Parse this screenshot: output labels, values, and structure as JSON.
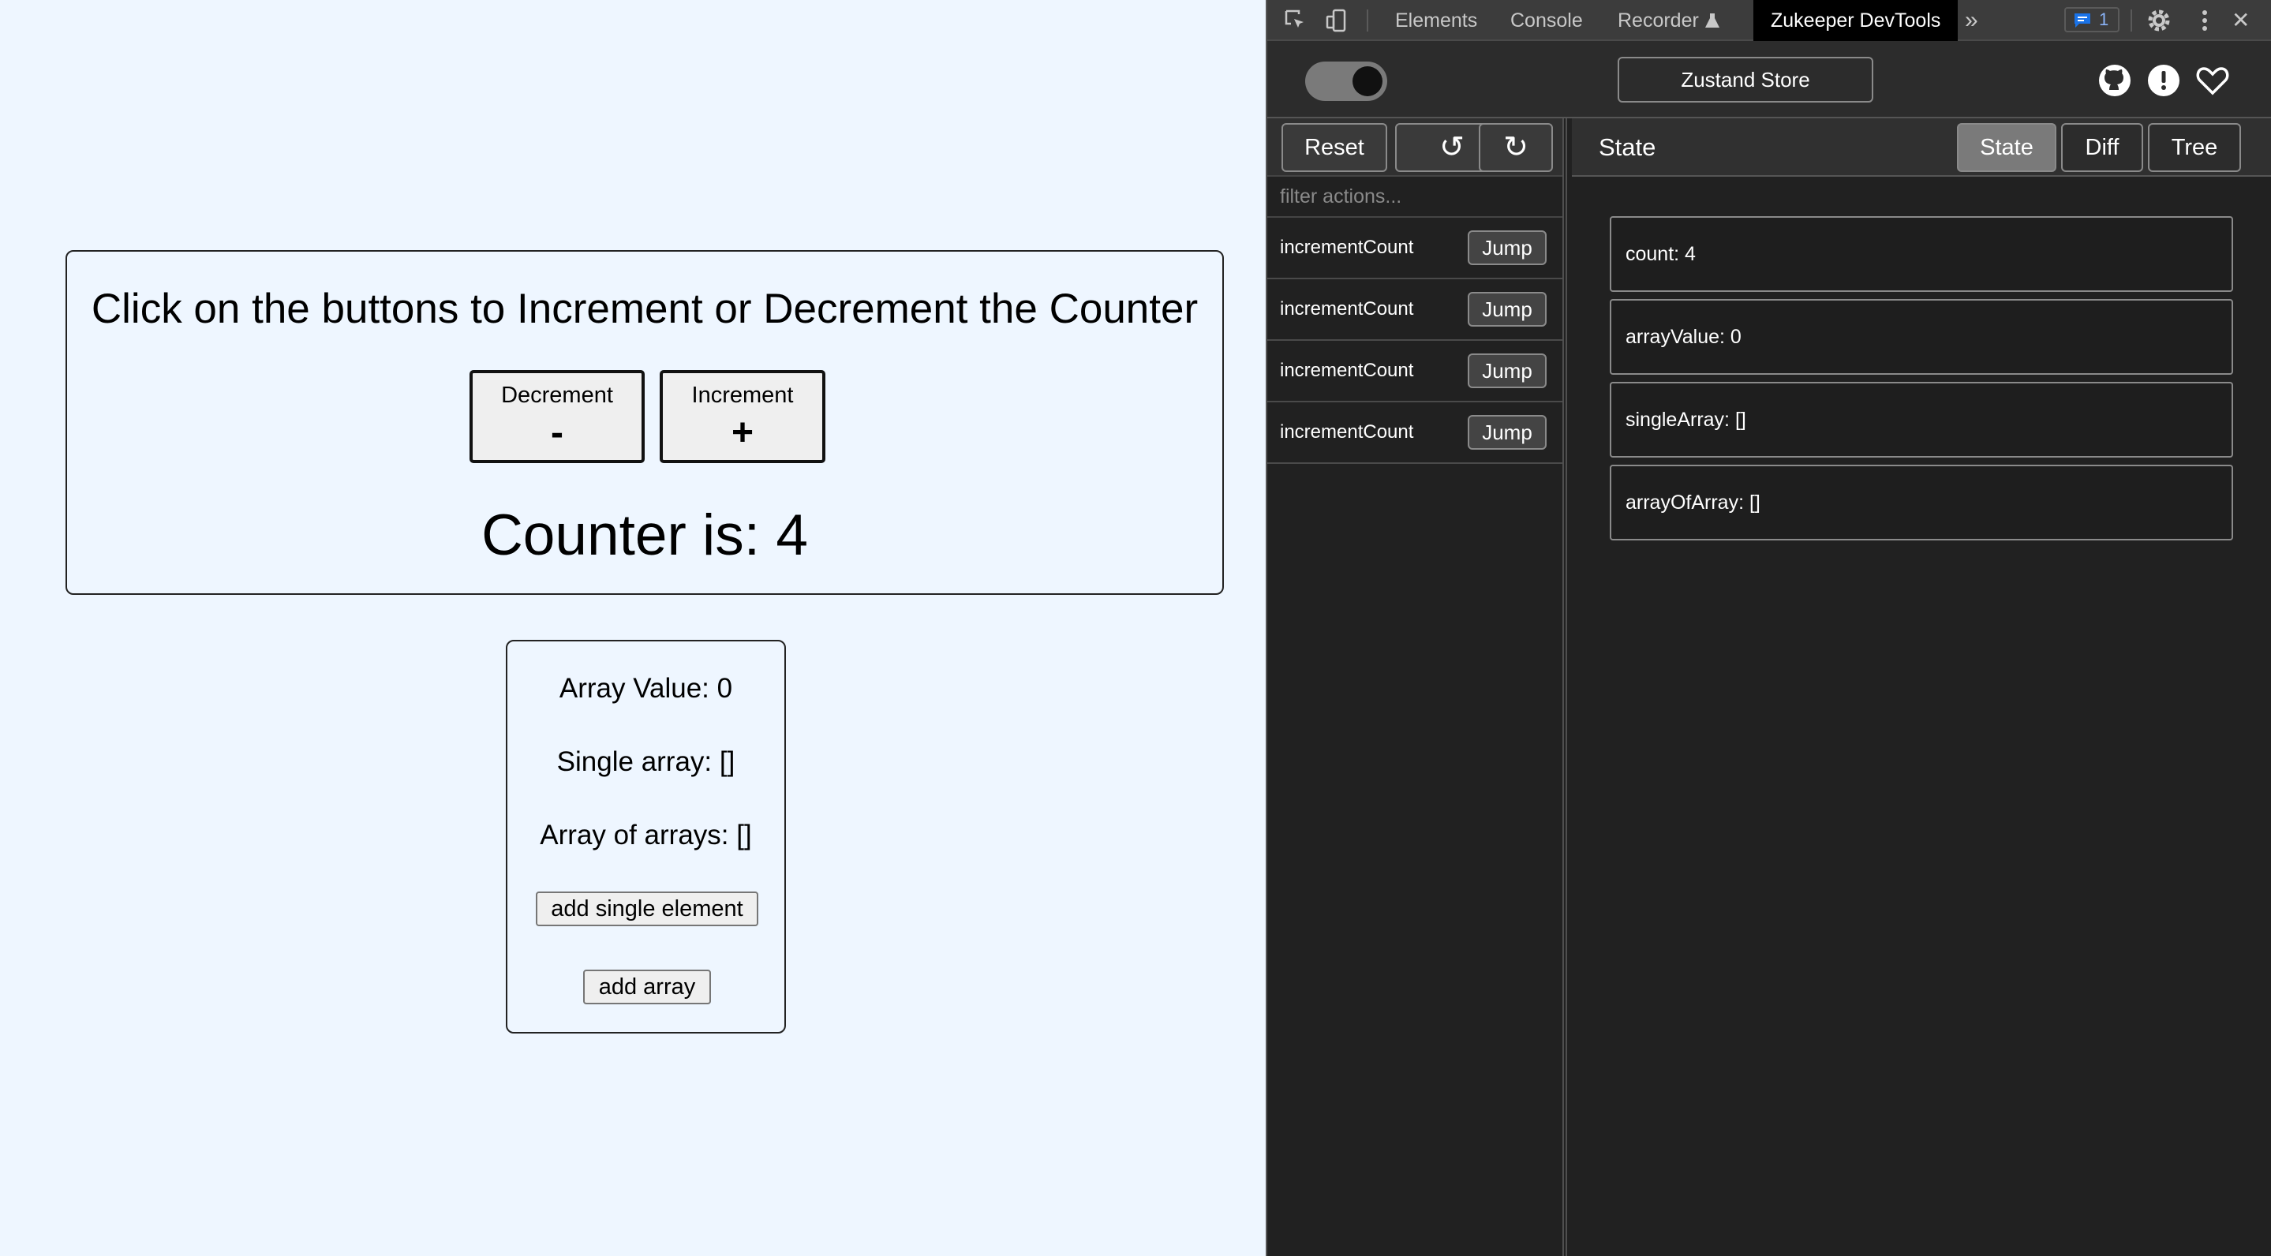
{
  "app": {
    "counter_title": "Click on the buttons to Increment or Decrement the Counter",
    "decrement_label": "Decrement",
    "decrement_symbol": "-",
    "increment_label": "Increment",
    "increment_symbol": "+",
    "counter_text": "Counter is: 4",
    "array_value_text": "Array Value: 0",
    "single_array_text": "Single array: []",
    "array_of_arrays_text": "Array of arrays: []",
    "add_single_label": "add single element",
    "add_array_label": "add array"
  },
  "devtools_tabs": {
    "elements": "Elements",
    "console": "Console",
    "recorder": "Recorder",
    "zukeeper": "Zukeeper DevTools",
    "more": "»",
    "issues_count": "1",
    "close": "✕"
  },
  "zukeeper": {
    "store_button": "Zustand Store",
    "reset_label": "Reset",
    "undo_icon": "↺",
    "redo_icon": "↻",
    "filter_placeholder": "filter actions...",
    "jump_label": "Jump",
    "actions": [
      {
        "name": "incrementCount"
      },
      {
        "name": "incrementCount"
      },
      {
        "name": "incrementCount"
      },
      {
        "name": "incrementCount"
      }
    ],
    "state_title": "State",
    "view_tabs": [
      "State",
      "Diff",
      "Tree"
    ],
    "state_items": [
      "count: 4",
      "arrayValue: 0",
      "singleArray: []",
      "arrayOfArray: []"
    ]
  }
}
